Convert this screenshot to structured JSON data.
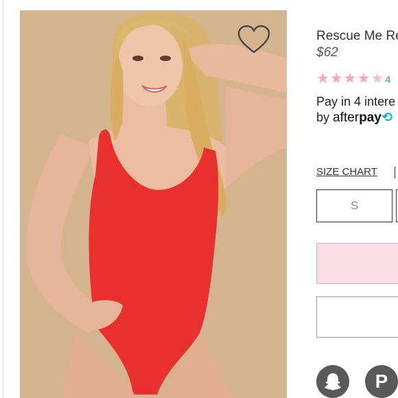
{
  "product": {
    "title": "Rescue Me Re",
    "price": "$62",
    "rating": {
      "value": 4.5,
      "stars": [
        "★",
        "★",
        "★",
        "★",
        "★"
      ],
      "count_partial": "4"
    }
  },
  "payment": {
    "line1": "Pay in 4 intere",
    "line2_prefix": "by",
    "afterpay_light": "after",
    "afterpay_bold": "pay",
    "afterpay_arrow": "⟲"
  },
  "size_chart": {
    "label": "SIZE CHART"
  },
  "sizes": {
    "options": [
      "S"
    ]
  },
  "social": {
    "snapchat_icon": "snapchat-icon",
    "pinterest_icon": "pinterest-icon",
    "pinterest_glyph": "P"
  },
  "colors": {
    "accent_pink": "#f9dde2",
    "star_pink": "#f2a7b6",
    "link_blue": "#2f8fc9",
    "afterpay_teal": "#1bb5c8",
    "swimsuit_red": "#e8302e",
    "background_tan": "#d2b18e"
  }
}
